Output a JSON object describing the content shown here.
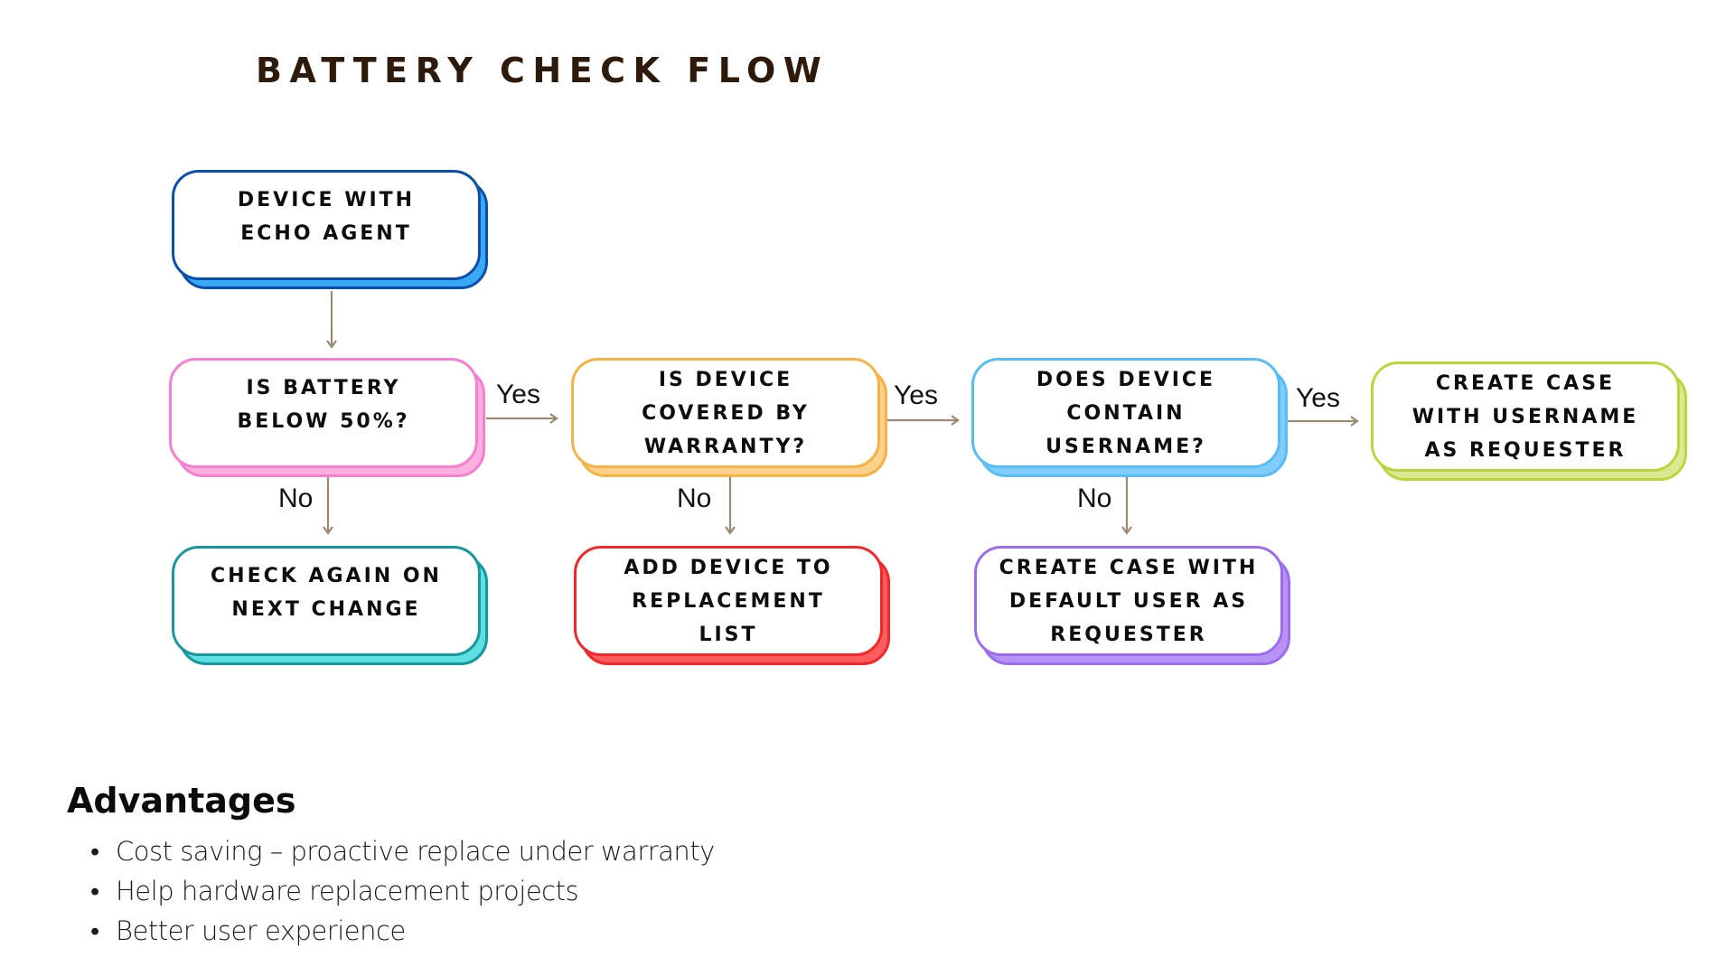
{
  "title": "BATTERY CHECK FLOW",
  "nodes": {
    "start": {
      "lines": [
        "DEVICE WITH",
        "ECHO AGENT"
      ],
      "border": "#0a4fad",
      "shadow": "#3aa9f5",
      "valign": "top"
    },
    "battery_check": {
      "lines": [
        "IS BATTERY",
        "BELOW 50%?"
      ],
      "border": "#f77fcf",
      "shadow": "#fbb0e0",
      "valign": "top"
    },
    "warranty_check": {
      "lines": [
        "IS DEVICE",
        "COVERED BY",
        "WARRANTY?"
      ],
      "border": "#f7b147",
      "shadow": "#fdd08b",
      "valign": "center"
    },
    "username_check": {
      "lines": [
        "DOES DEVICE",
        "CONTAIN",
        "USERNAME?"
      ],
      "border": "#58bdf7",
      "shadow": "#80cdfb",
      "valign": "center"
    },
    "case_with_username": {
      "lines": [
        "CREATE CASE",
        "WITH USERNAME",
        "AS REQUESTER"
      ],
      "border": "#b9d63a",
      "shadow": "#d8ea93",
      "valign": "center"
    },
    "check_again": {
      "lines": [
        "CHECK AGAIN ON",
        "NEXT CHANGE"
      ],
      "border": "#16989c",
      "shadow": "#5ee0e2",
      "valign": "top"
    },
    "replacement_list": {
      "lines": [
        "ADD DEVICE TO",
        "REPLACEMENT",
        "LIST"
      ],
      "border": "#f3262a",
      "shadow": "#ff5c5e",
      "valign": "center"
    },
    "case_default_user": {
      "lines": [
        "CREATE CASE WITH",
        "DEFAULT USER AS",
        "REQUESTER"
      ],
      "border": "#9b6cf0",
      "shadow": "#b793f5",
      "valign": "center"
    }
  },
  "edges": {
    "start_to_battery": "",
    "battery_yes": "Yes",
    "battery_no": "No",
    "warranty_yes": "Yes",
    "warranty_no": "No",
    "username_yes": "Yes",
    "username_no": "No"
  },
  "arrow_color": "#9c8a73",
  "advantages": {
    "heading": "Advantages",
    "items": [
      "Cost saving – proactive  replace  under  warranty",
      "Help  hardware  replacement  projects",
      "Better  user  experience"
    ],
    "bullet": "•"
  }
}
